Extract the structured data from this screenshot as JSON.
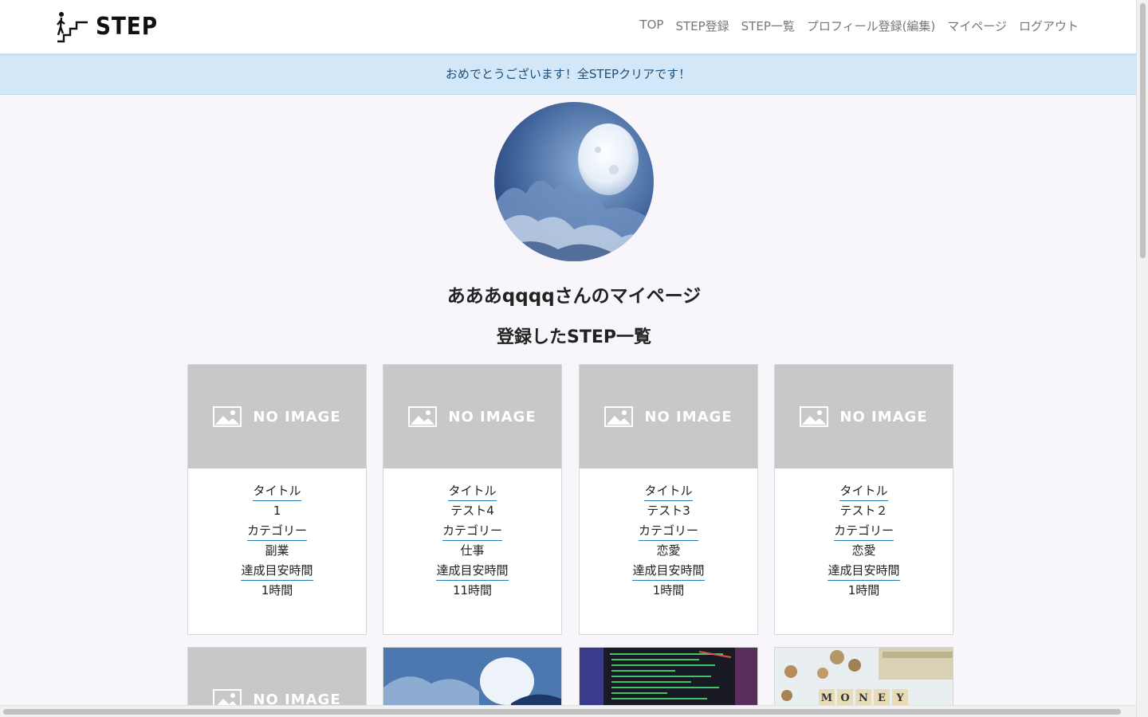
{
  "header": {
    "logo_text": "STEP",
    "nav": [
      {
        "label": "TOP"
      },
      {
        "label": "STEP登録"
      },
      {
        "label": "STEP一覧"
      },
      {
        "label": "プロフィール登録(編集)"
      },
      {
        "label": "マイページ"
      },
      {
        "label": "ログアウト"
      }
    ]
  },
  "alert": {
    "message": "おめでとうございます！全STEPクリアです！"
  },
  "profile": {
    "page_title": "あああqqqqさんのマイページ"
  },
  "steps_section": {
    "title": "登録したSTEP一覧"
  },
  "no_image_text": "NO IMAGE",
  "card_labels": {
    "title": "タイトル",
    "category": "カテゴリー",
    "time": "達成目安時間"
  },
  "cards": [
    {
      "title": "1",
      "category": "副業",
      "time": "1時間"
    },
    {
      "title": "テスト4",
      "category": "仕事",
      "time": "11時間"
    },
    {
      "title": "テスト3",
      "category": "恋愛",
      "time": "1時間"
    },
    {
      "title": "テスト２",
      "category": "恋愛",
      "time": "1時間"
    }
  ],
  "second_row_images": [
    {
      "type": "no-image"
    },
    {
      "type": "moon-photo"
    },
    {
      "type": "code-screen-photo"
    },
    {
      "type": "money-photo",
      "caption": "MONEY"
    }
  ],
  "colors": {
    "background": "#f8f6fb",
    "alert_bg": "#d2e8f8",
    "alert_text": "#1d4e77",
    "label_underline": "#2b7bb6",
    "placeholder_gray": "#c8c8c8"
  }
}
